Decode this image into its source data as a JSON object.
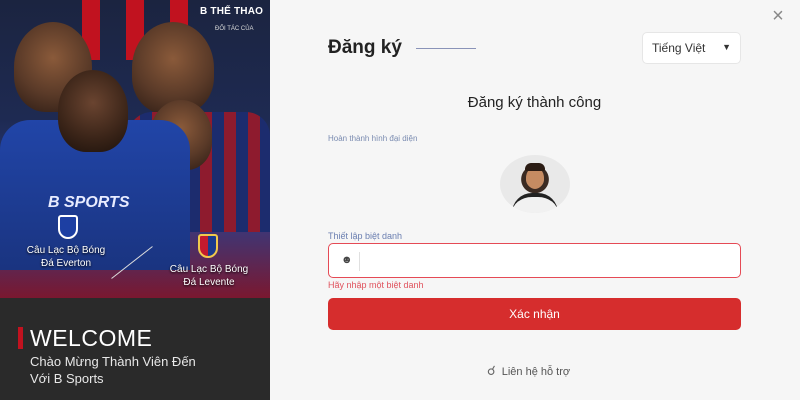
{
  "promo": {
    "brand": "B THỂ THAO",
    "brand_sub": "ĐỐI TÁC CỦA",
    "shirt_logo": "B SPORTS",
    "club1_caption": [
      "Câu Lạc Bộ Bóng",
      "Đá Everton"
    ],
    "club2_caption": [
      "Câu Lạc Bộ Bóng",
      "Đá Levente"
    ],
    "welcome_title": "WELCOME",
    "welcome_line1": "Chào Mừng Thành Viên Đến",
    "welcome_line2": "Với B  Sports",
    "accent_color": "#c1121f"
  },
  "form": {
    "close_icon": "×",
    "title": "Đăng ký",
    "language": "Tiếng Việt",
    "success_message": "Đăng ký thành công",
    "avatar_label": "Hoàn thành hình đại diện",
    "nickname_label": "Thiết lập biệt danh",
    "nickname_value": "",
    "nickname_placeholder": "",
    "error_message": "Hãy nhập một biệt danh",
    "confirm_button": "Xác nhận",
    "support_link": "Liên hệ hỗ trợ",
    "primary_color": "#d62d2d",
    "error_color": "#e0525d"
  }
}
